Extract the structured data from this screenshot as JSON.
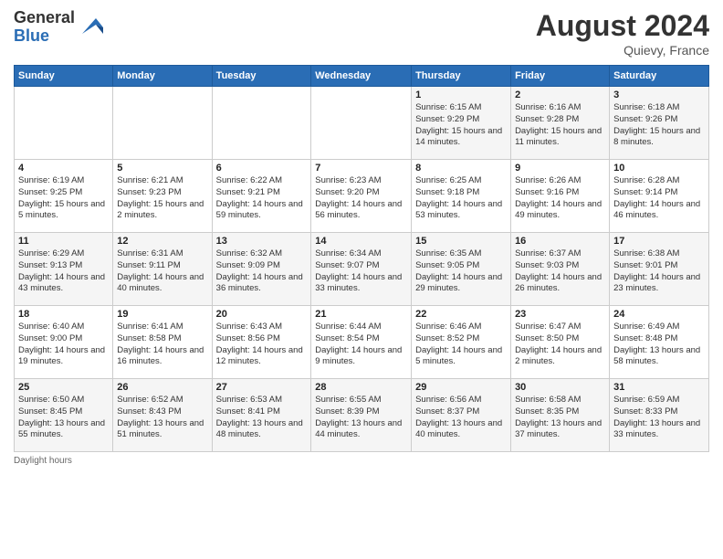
{
  "header": {
    "logo_general": "General",
    "logo_blue": "Blue",
    "month_title": "August 2024",
    "location": "Quievy, France"
  },
  "days_of_week": [
    "Sunday",
    "Monday",
    "Tuesday",
    "Wednesday",
    "Thursday",
    "Friday",
    "Saturday"
  ],
  "weeks": [
    [
      {
        "day": "",
        "info": ""
      },
      {
        "day": "",
        "info": ""
      },
      {
        "day": "",
        "info": ""
      },
      {
        "day": "",
        "info": ""
      },
      {
        "day": "1",
        "info": "Sunrise: 6:15 AM\nSunset: 9:29 PM\nDaylight: 15 hours\nand 14 minutes."
      },
      {
        "day": "2",
        "info": "Sunrise: 6:16 AM\nSunset: 9:28 PM\nDaylight: 15 hours\nand 11 minutes."
      },
      {
        "day": "3",
        "info": "Sunrise: 6:18 AM\nSunset: 9:26 PM\nDaylight: 15 hours\nand 8 minutes."
      }
    ],
    [
      {
        "day": "4",
        "info": "Sunrise: 6:19 AM\nSunset: 9:25 PM\nDaylight: 15 hours\nand 5 minutes."
      },
      {
        "day": "5",
        "info": "Sunrise: 6:21 AM\nSunset: 9:23 PM\nDaylight: 15 hours\nand 2 minutes."
      },
      {
        "day": "6",
        "info": "Sunrise: 6:22 AM\nSunset: 9:21 PM\nDaylight: 14 hours\nand 59 minutes."
      },
      {
        "day": "7",
        "info": "Sunrise: 6:23 AM\nSunset: 9:20 PM\nDaylight: 14 hours\nand 56 minutes."
      },
      {
        "day": "8",
        "info": "Sunrise: 6:25 AM\nSunset: 9:18 PM\nDaylight: 14 hours\nand 53 minutes."
      },
      {
        "day": "9",
        "info": "Sunrise: 6:26 AM\nSunset: 9:16 PM\nDaylight: 14 hours\nand 49 minutes."
      },
      {
        "day": "10",
        "info": "Sunrise: 6:28 AM\nSunset: 9:14 PM\nDaylight: 14 hours\nand 46 minutes."
      }
    ],
    [
      {
        "day": "11",
        "info": "Sunrise: 6:29 AM\nSunset: 9:13 PM\nDaylight: 14 hours\nand 43 minutes."
      },
      {
        "day": "12",
        "info": "Sunrise: 6:31 AM\nSunset: 9:11 PM\nDaylight: 14 hours\nand 40 minutes."
      },
      {
        "day": "13",
        "info": "Sunrise: 6:32 AM\nSunset: 9:09 PM\nDaylight: 14 hours\nand 36 minutes."
      },
      {
        "day": "14",
        "info": "Sunrise: 6:34 AM\nSunset: 9:07 PM\nDaylight: 14 hours\nand 33 minutes."
      },
      {
        "day": "15",
        "info": "Sunrise: 6:35 AM\nSunset: 9:05 PM\nDaylight: 14 hours\nand 29 minutes."
      },
      {
        "day": "16",
        "info": "Sunrise: 6:37 AM\nSunset: 9:03 PM\nDaylight: 14 hours\nand 26 minutes."
      },
      {
        "day": "17",
        "info": "Sunrise: 6:38 AM\nSunset: 9:01 PM\nDaylight: 14 hours\nand 23 minutes."
      }
    ],
    [
      {
        "day": "18",
        "info": "Sunrise: 6:40 AM\nSunset: 9:00 PM\nDaylight: 14 hours\nand 19 minutes."
      },
      {
        "day": "19",
        "info": "Sunrise: 6:41 AM\nSunset: 8:58 PM\nDaylight: 14 hours\nand 16 minutes."
      },
      {
        "day": "20",
        "info": "Sunrise: 6:43 AM\nSunset: 8:56 PM\nDaylight: 14 hours\nand 12 minutes."
      },
      {
        "day": "21",
        "info": "Sunrise: 6:44 AM\nSunset: 8:54 PM\nDaylight: 14 hours\nand 9 minutes."
      },
      {
        "day": "22",
        "info": "Sunrise: 6:46 AM\nSunset: 8:52 PM\nDaylight: 14 hours\nand 5 minutes."
      },
      {
        "day": "23",
        "info": "Sunrise: 6:47 AM\nSunset: 8:50 PM\nDaylight: 14 hours\nand 2 minutes."
      },
      {
        "day": "24",
        "info": "Sunrise: 6:49 AM\nSunset: 8:48 PM\nDaylight: 13 hours\nand 58 minutes."
      }
    ],
    [
      {
        "day": "25",
        "info": "Sunrise: 6:50 AM\nSunset: 8:45 PM\nDaylight: 13 hours\nand 55 minutes."
      },
      {
        "day": "26",
        "info": "Sunrise: 6:52 AM\nSunset: 8:43 PM\nDaylight: 13 hours\nand 51 minutes."
      },
      {
        "day": "27",
        "info": "Sunrise: 6:53 AM\nSunset: 8:41 PM\nDaylight: 13 hours\nand 48 minutes."
      },
      {
        "day": "28",
        "info": "Sunrise: 6:55 AM\nSunset: 8:39 PM\nDaylight: 13 hours\nand 44 minutes."
      },
      {
        "day": "29",
        "info": "Sunrise: 6:56 AM\nSunset: 8:37 PM\nDaylight: 13 hours\nand 40 minutes."
      },
      {
        "day": "30",
        "info": "Sunrise: 6:58 AM\nSunset: 8:35 PM\nDaylight: 13 hours\nand 37 minutes."
      },
      {
        "day": "31",
        "info": "Sunrise: 6:59 AM\nSunset: 8:33 PM\nDaylight: 13 hours\nand 33 minutes."
      }
    ]
  ],
  "footer": {
    "note": "Daylight hours"
  }
}
